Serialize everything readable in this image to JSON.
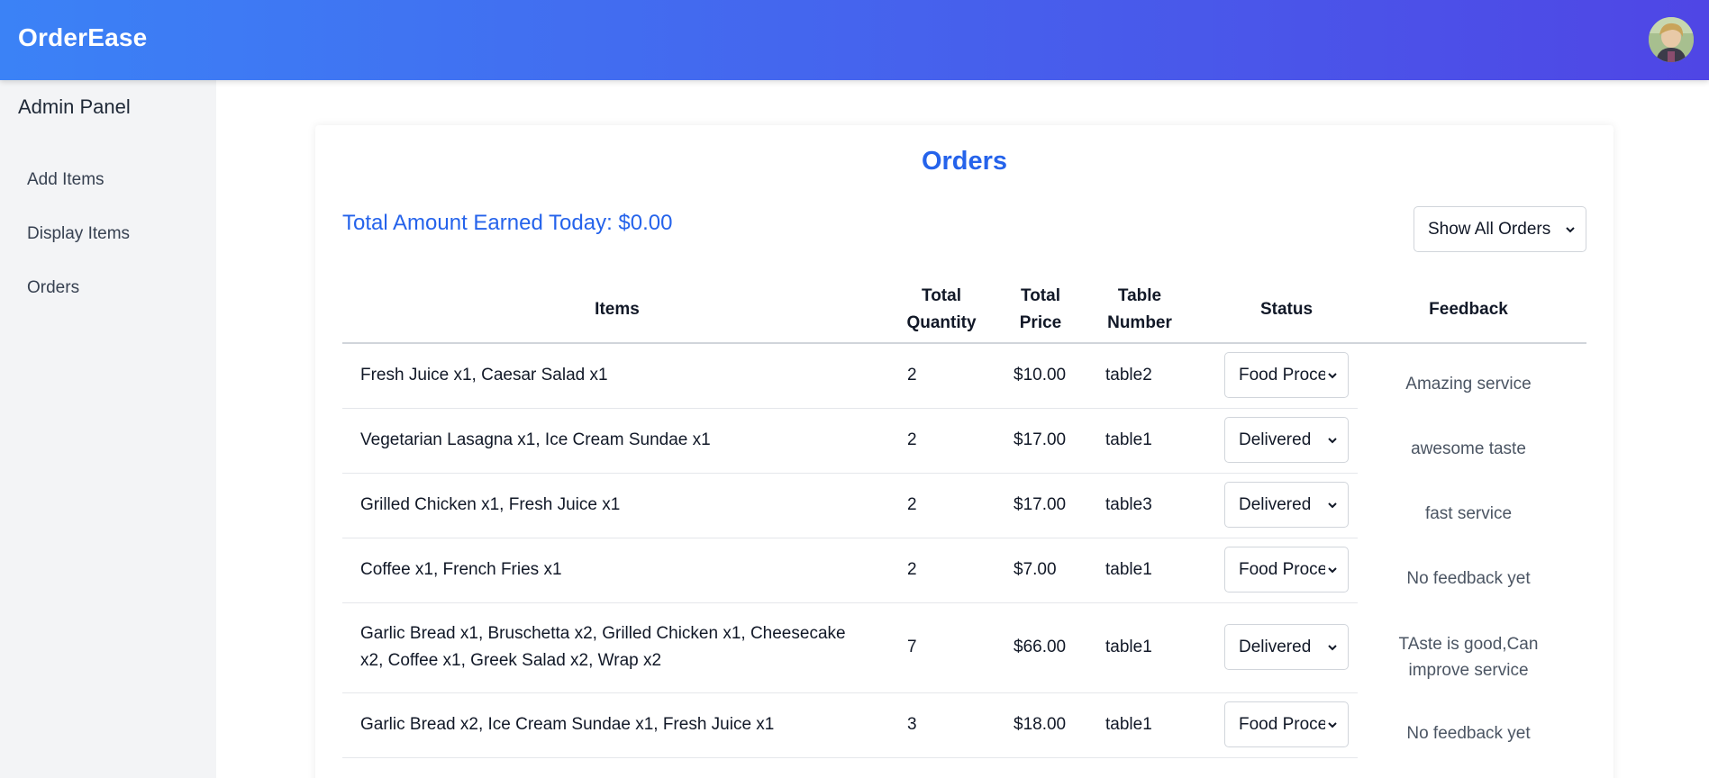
{
  "header": {
    "brand": "OrderEase"
  },
  "sidebar": {
    "title": "Admin Panel",
    "items": [
      {
        "label": "Add Items"
      },
      {
        "label": "Display Items"
      },
      {
        "label": "Orders"
      }
    ]
  },
  "main": {
    "title": "Orders",
    "earned": "Total Amount Earned Today: $0.00",
    "filter": "Show All Orders",
    "columns": {
      "items": "Items",
      "qty_1": "Total",
      "qty_2": "Quantity",
      "price_1": "Total",
      "price_2": "Price",
      "table_1": "Table",
      "table_2": "Number",
      "status": "Status",
      "feedback": "Feedback"
    },
    "orders": [
      {
        "items": "Fresh Juice x1, Caesar Salad x1",
        "qty": "2",
        "price": "$10.00",
        "table": "table2",
        "status": "Food Processing",
        "feedback": "Amazing service"
      },
      {
        "items": "Vegetarian Lasagna x1, Ice Cream Sundae x1",
        "qty": "2",
        "price": "$17.00",
        "table": "table1",
        "status": "Delivered",
        "feedback": "awesome taste"
      },
      {
        "items": "Grilled Chicken x1, Fresh Juice x1",
        "qty": "2",
        "price": "$17.00",
        "table": "table3",
        "status": "Delivered",
        "feedback": "fast service"
      },
      {
        "items": "Coffee x1, French Fries x1",
        "qty": "2",
        "price": "$7.00",
        "table": "table1",
        "status": "Food Processing",
        "feedback": "No feedback yet"
      },
      {
        "items_1": "Garlic Bread x1, Bruschetta x2, Grilled Chicken x1, Cheesecake",
        "items_2": "x2, Coffee x1, Greek Salad x2, Wrap x2",
        "qty": "7",
        "price": "$66.00",
        "table": "table1",
        "status": "Delivered",
        "feedback_1": "TAste is good,Can",
        "feedback_2": "improve service"
      },
      {
        "items": "Garlic Bread x2, Ice Cream Sundae x1, Fresh Juice x1",
        "qty": "3",
        "price": "$18.00",
        "table": "table1",
        "status": "Food Processing",
        "feedback": "No feedback yet"
      }
    ]
  },
  "icons": {
    "chevron": "chevron-down-icon",
    "avatar": "user-avatar"
  }
}
